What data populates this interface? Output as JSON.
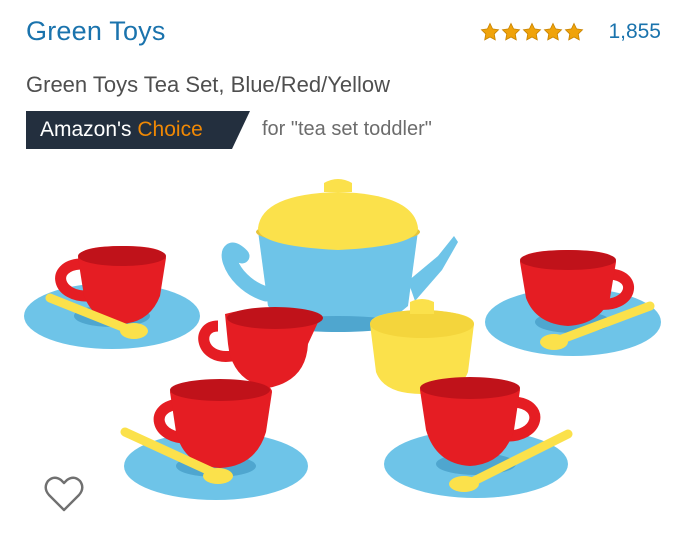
{
  "header": {
    "brand": "Green Toys",
    "rating": {
      "stars": 5,
      "review_count": "1,855"
    }
  },
  "product": {
    "title": "Green Toys Tea Set, Blue/Red/Yellow"
  },
  "badge": {
    "prefix": "Amazon's",
    "accent": "Choice",
    "for_text": "for \"tea set toddler\"",
    "bg_color": "#232f3e",
    "accent_color": "#f08804"
  },
  "colors": {
    "link": "#1a73ad",
    "star": "#f0a30a",
    "cup_red": "#e51d23",
    "saucer_blue": "#6ec4e8",
    "lid_yellow": "#fbe14b"
  },
  "icons": {
    "wishlist": "heart-outline-icon",
    "star": "star-icon"
  }
}
